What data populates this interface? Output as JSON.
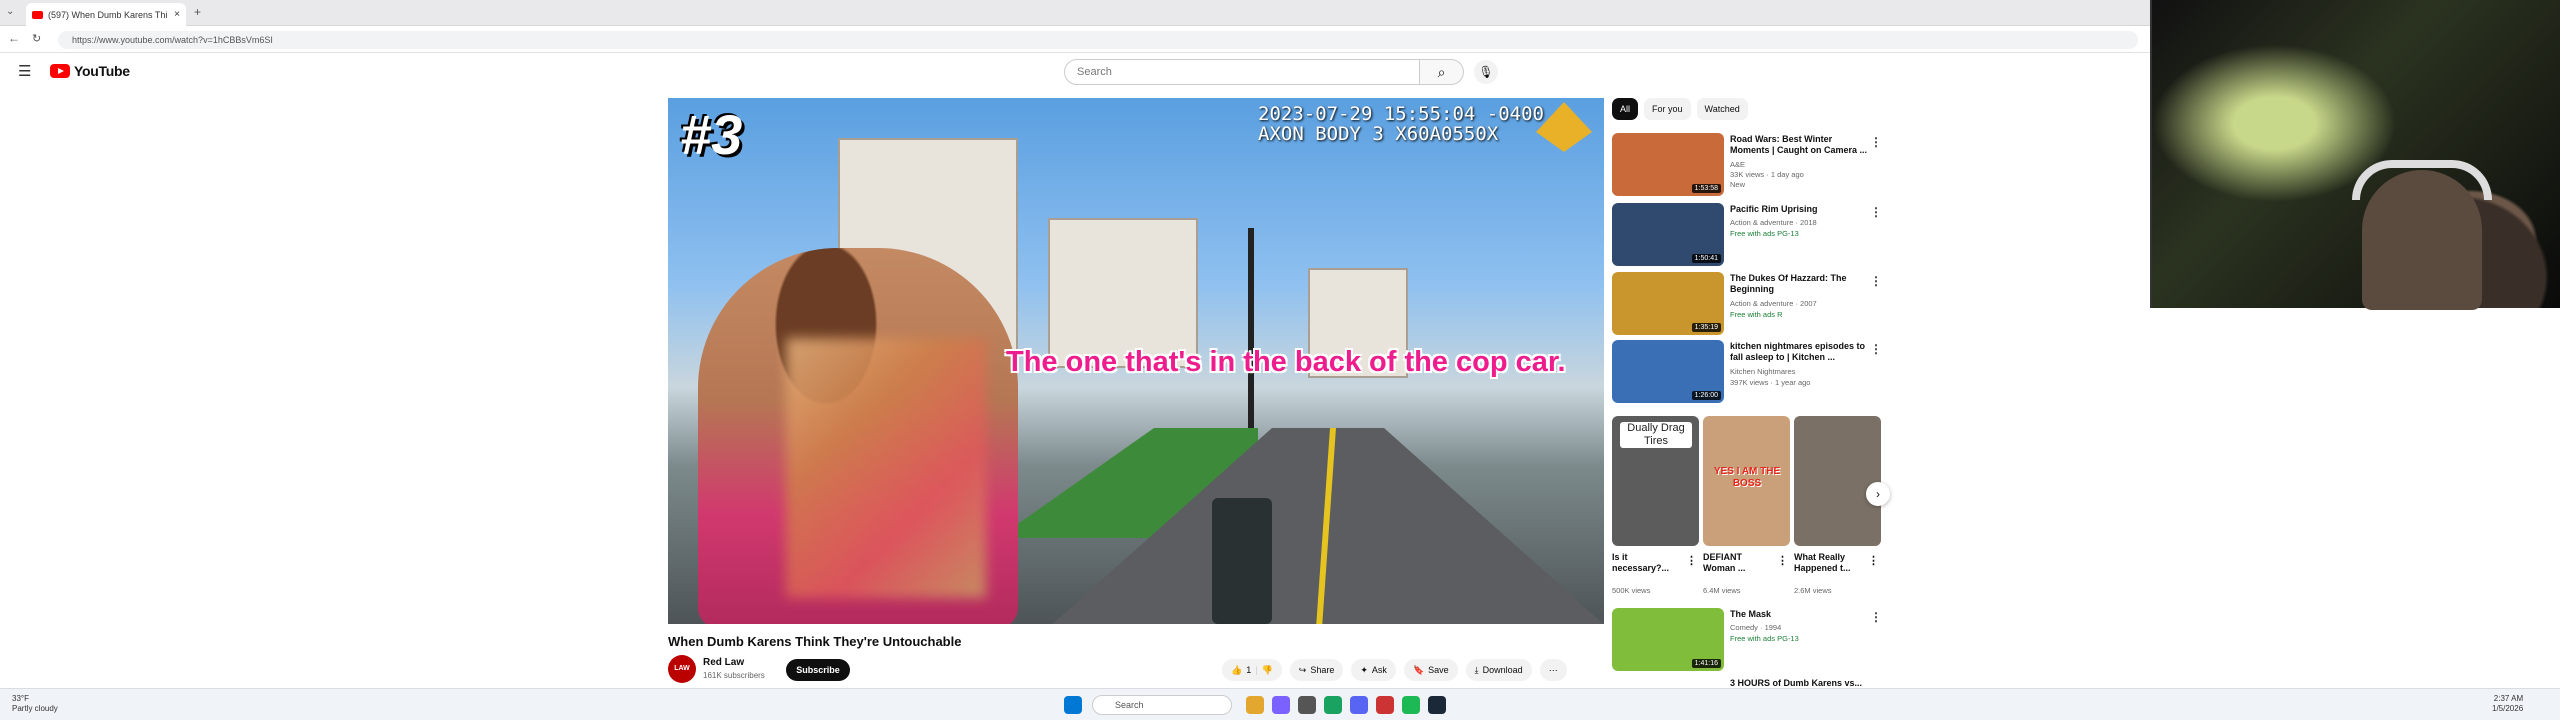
{
  "browser": {
    "tab_title": "(597) When Dumb Karens Thi",
    "url": "https://www.youtube.com/watch?v=1hCBBsVm6SI",
    "new_tab": "+"
  },
  "header": {
    "logo": "YouTube",
    "search_placeholder": "Search"
  },
  "video": {
    "overlay_number": "#3",
    "timestamp": "2023-07-29 15:55:04 -0400\nAXON BODY 3 X60A0550X",
    "caption": "The one that's in the back of the cop car.",
    "title": "When Dumb Karens Think They're Untouchable",
    "channel": "Red Law",
    "avatar_text": "LAW",
    "subscribers": "161K subscribers",
    "subscribe": "Subscribe",
    "like_count": "1",
    "share": "Share",
    "ask": "Ask",
    "save": "Save",
    "download": "Download"
  },
  "filters": [
    "All",
    "For you",
    "Watched"
  ],
  "recommendations": [
    {
      "title": "Road Wars: Best Winter Moments | Caught on Camera ...",
      "meta1": "A&E",
      "meta2": "33K views · 1 day ago",
      "meta3": "New",
      "duration": "1:53:58",
      "color": "#c96a3a"
    },
    {
      "title": "Pacific Rim Uprising",
      "meta1": "Action & adventure · 2018",
      "meta2": "Free with ads  PG-13",
      "meta3": "",
      "duration": "1:50:41",
      "color": "#2f4a6e"
    },
    {
      "title": "The Dukes Of Hazzard: The Beginning",
      "meta1": "Action & adventure · 2007",
      "meta2": "Free with ads  R",
      "meta3": "",
      "duration": "1:35:19",
      "color": "#c9962e"
    },
    {
      "title": "kitchen nightmares episodes to fall asleep to | Kitchen ...",
      "meta1": "Kitchen Nightmares",
      "meta2": "397K views · 1 year ago",
      "meta3": "",
      "duration": "1:26:00",
      "color": "#3a6eb5"
    }
  ],
  "shorts": [
    {
      "label": "Is it necessary?...",
      "views": "500K views",
      "text": "Dually Drag Tires",
      "color": "#5c5c5c"
    },
    {
      "label": "DEFIANT Woman ...",
      "views": "6.4M views",
      "text": "YES I AM THE BOSS",
      "color": "#c9a07a"
    },
    {
      "label": "What Really Happened t...",
      "views": "2.6M views",
      "text": "",
      "color": "#7a7065"
    }
  ],
  "rec_bottom": [
    {
      "title": "The Mask",
      "meta1": "Comedy · 1994",
      "meta2": "Free with ads  PG-13",
      "duration": "1:41:16",
      "color": "#7fbd3a"
    },
    {
      "title": "3 HOURS of Dumb Karens vs...",
      "meta1": "",
      "meta2": "",
      "duration": "",
      "color": "#888"
    }
  ],
  "taskbar": {
    "weather_temp": "33°F",
    "weather_desc": "Partly cloudy",
    "search": "Search",
    "time": "2:37 AM",
    "date": "1/5/2026"
  }
}
